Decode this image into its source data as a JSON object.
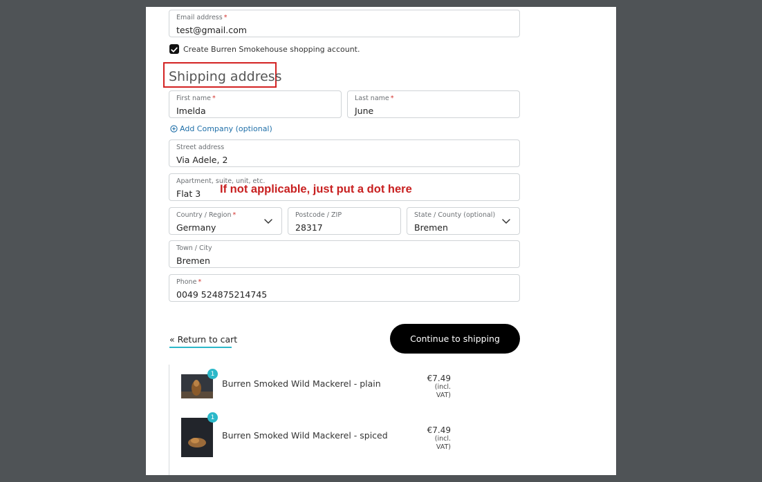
{
  "account": {
    "email_label": "Email address",
    "email_value": "test@gmail.com",
    "create_account_label": "Create Burren Smokehouse shopping account.",
    "create_account_checked": true
  },
  "shipping": {
    "title": "Shipping address",
    "first_name_label": "First name",
    "first_name_value": "Imelda",
    "last_name_label": "Last name",
    "last_name_value": "June",
    "add_company": "Add Company (optional)",
    "street_label": "Street address",
    "street_value": "Via Adele, 2",
    "apartment_label": "Apartment, suite, unit, etc.",
    "apartment_value": "Flat 3",
    "annotation": "If not applicable, just put a dot here",
    "country_label": "Country / Region",
    "country_value": "Germany",
    "postcode_label": "Postcode / ZIP",
    "postcode_value": "28317",
    "state_label": "State / County (optional)",
    "state_value": "Bremen",
    "town_label": "Town / City",
    "town_value": "Bremen",
    "phone_label": "Phone",
    "phone_value": "0049 524875214745",
    "required_marker": "*"
  },
  "actions": {
    "return_label": "« Return to cart",
    "continue_label": "Continue to shipping"
  },
  "cart": {
    "items": [
      {
        "name": "Burren Smoked Wild Mackerel - plain",
        "quantity": "1",
        "price": "€7.49",
        "vat_line1": "(incl.",
        "vat_line2": "VAT)"
      },
      {
        "name": "Burren Smoked Wild Mackerel - spiced",
        "quantity": "1",
        "price": "€7.49",
        "vat_line1": "(incl.",
        "vat_line2": "VAT)"
      }
    ]
  },
  "colors": {
    "accent": "#2bb8c9",
    "annotation_red": "#d32222",
    "button_black": "#000000",
    "link_blue": "#1f6fa8"
  }
}
